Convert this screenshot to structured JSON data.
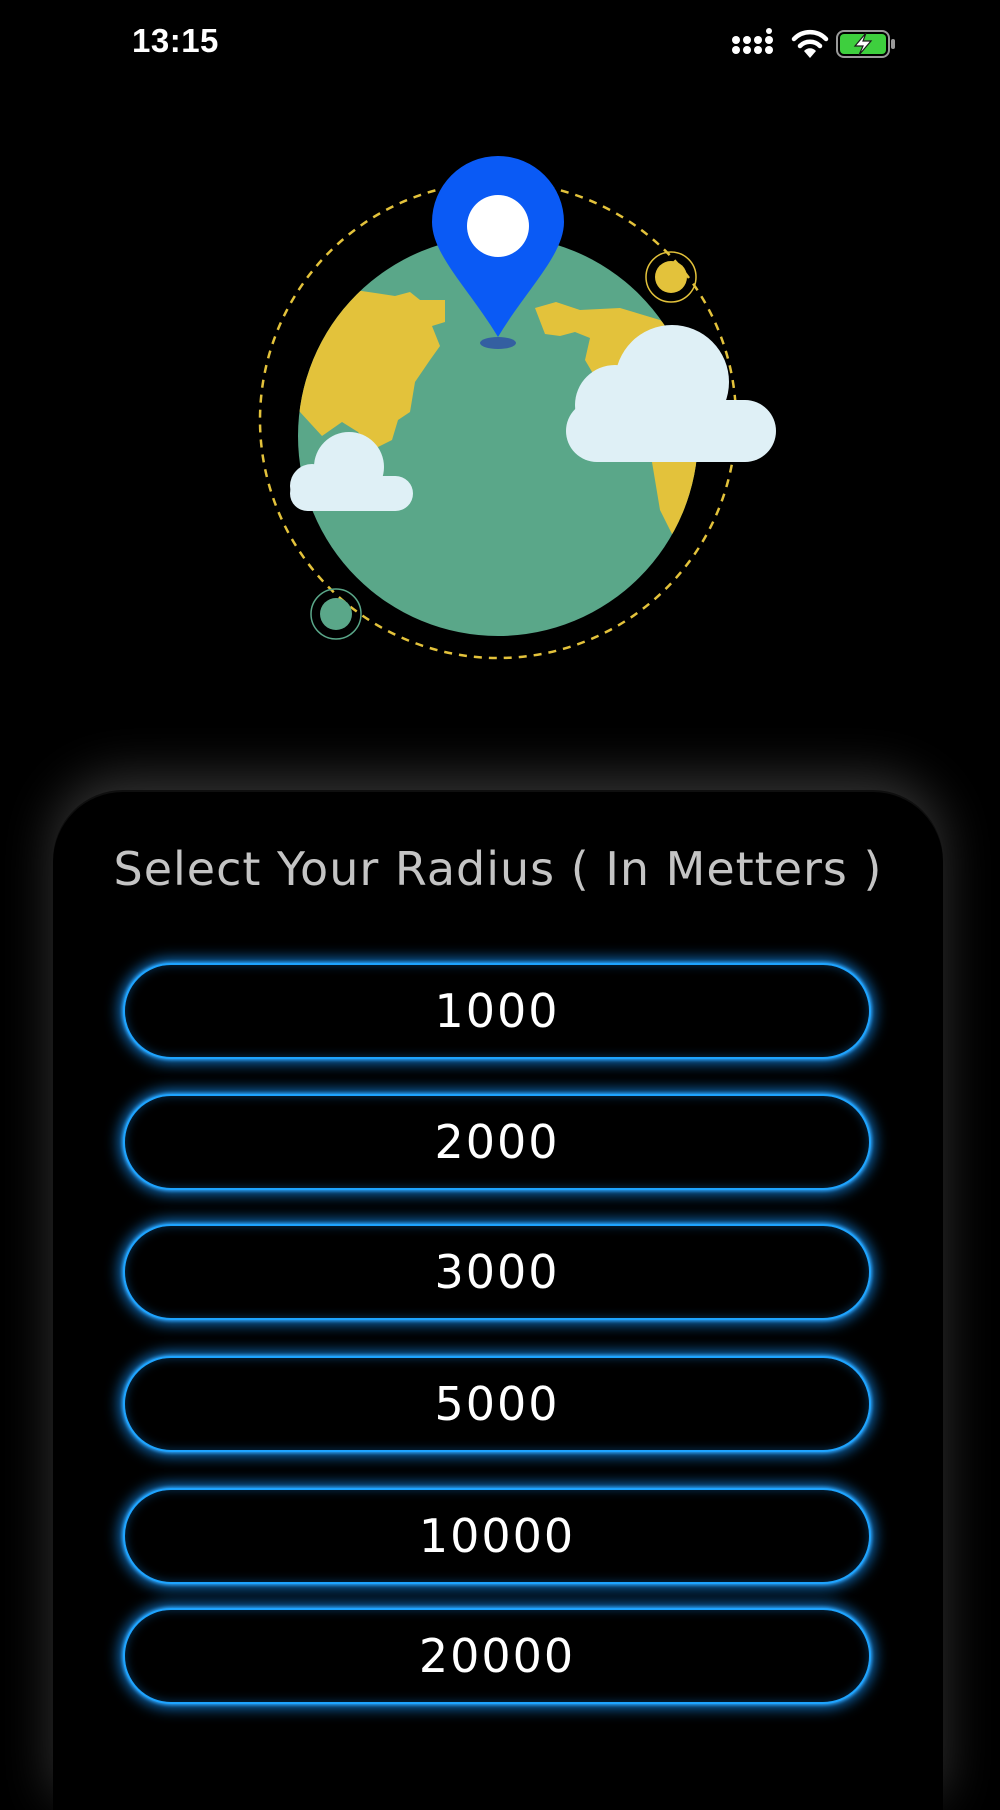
{
  "status_bar": {
    "time": "13:15",
    "icons": [
      "cellular-signal-icon",
      "wifi-icon",
      "battery-charging-icon"
    ]
  },
  "hero": {
    "illustration": "globe-location-pin-illustration",
    "colors": {
      "ocean": "#5aa789",
      "land": "#e3c23b",
      "pin": "#0a5af5",
      "cloud": "#dff0f6",
      "orbit": "#e3c23b"
    }
  },
  "radius_selector": {
    "title": "Select Your Radius ( In Metters )",
    "options": [
      {
        "label": "1000"
      },
      {
        "label": "2000"
      },
      {
        "label": "3000"
      },
      {
        "label": "5000"
      },
      {
        "label": "10000"
      },
      {
        "label": "20000"
      }
    ],
    "accent_color": "#1ea4ff"
  }
}
